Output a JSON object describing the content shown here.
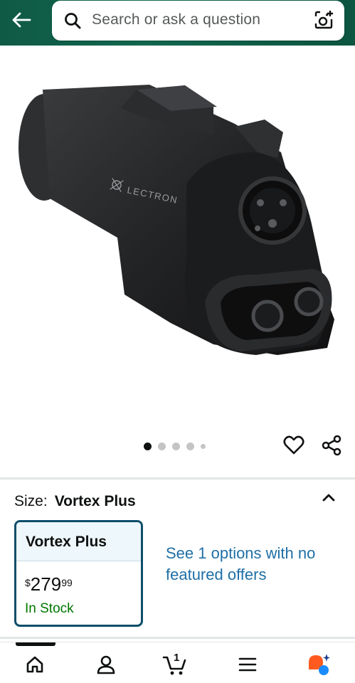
{
  "header": {
    "search_placeholder": "Search or ask a question",
    "icons": [
      "back-arrow-icon",
      "search-icon",
      "camera-icon"
    ]
  },
  "product_image": {
    "brand_mark": "LECTRON",
    "carousel": {
      "total": 5,
      "active": 1
    }
  },
  "actions": {
    "icons": [
      "heart-icon",
      "share-icon"
    ]
  },
  "size": {
    "label": "Size:",
    "value": "Vortex Plus",
    "card": {
      "title": "Vortex Plus",
      "price_symbol": "$",
      "price_whole": "279",
      "price_fraction": "99",
      "stock": "In Stock"
    },
    "options_text": "See 1 options with no featured offers"
  },
  "bottom_nav": {
    "cart_count": "1",
    "icons": [
      "home-icon",
      "account-icon",
      "cart-icon",
      "menu-icon",
      "assistant-icon"
    ]
  },
  "colors": {
    "header": "#12664e",
    "link": "#1f6fa6",
    "stock": "#007600",
    "card_border": "#0d4e6b"
  }
}
